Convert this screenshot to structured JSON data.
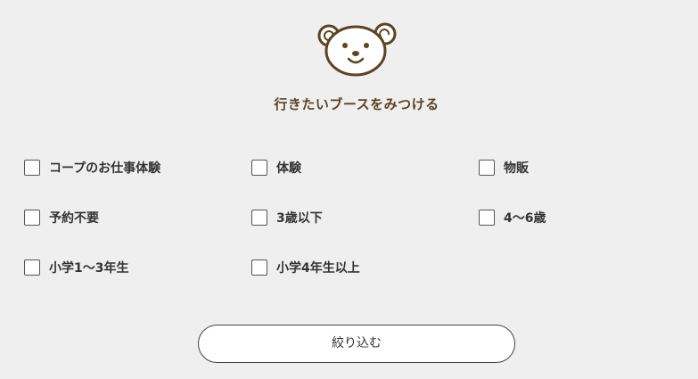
{
  "heading": "行きたいブースをみつける",
  "filters": [
    {
      "label": "コープのお仕事体験",
      "checked": false
    },
    {
      "label": "体験",
      "checked": false
    },
    {
      "label": "物販",
      "checked": false
    },
    {
      "label": "予約不要",
      "checked": false
    },
    {
      "label": "3歳以下",
      "checked": false
    },
    {
      "label": "4〜6歳",
      "checked": false
    },
    {
      "label": "小学1〜3年生",
      "checked": false
    },
    {
      "label": "小学4年生以上",
      "checked": false
    }
  ],
  "submit_label": "絞り込む",
  "icons": {
    "logo": "bear-face-icon",
    "checkbox": "checkbox-unchecked-icon"
  },
  "colors": {
    "background": "#efefef",
    "brand_brown": "#5c4322",
    "text": "#333333"
  }
}
